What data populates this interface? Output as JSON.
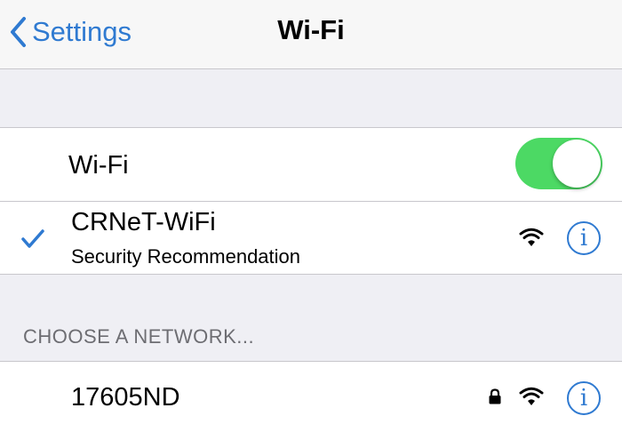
{
  "navbar": {
    "back_label": "Settings",
    "title": "Wi-Fi"
  },
  "wifi_toggle": {
    "label": "Wi-Fi",
    "on": true
  },
  "connected_network": {
    "name": "CRNeT-WiFi",
    "subtitle": "Security Recommendation",
    "icons": [
      "checkmark-icon",
      "wifi-signal-icon",
      "info-icon"
    ]
  },
  "networks_section": {
    "header": "CHOOSE A NETWORK...",
    "networks": [
      {
        "name": "17605ND",
        "secured": true,
        "icons": [
          "lock-icon",
          "wifi-signal-icon",
          "info-icon"
        ]
      }
    ]
  },
  "info_glyph": "i",
  "colors": {
    "accent": "#2f7ad1",
    "toggle_on": "#4cd964",
    "background": "#efeff4",
    "separator": "#c8c7cc"
  }
}
